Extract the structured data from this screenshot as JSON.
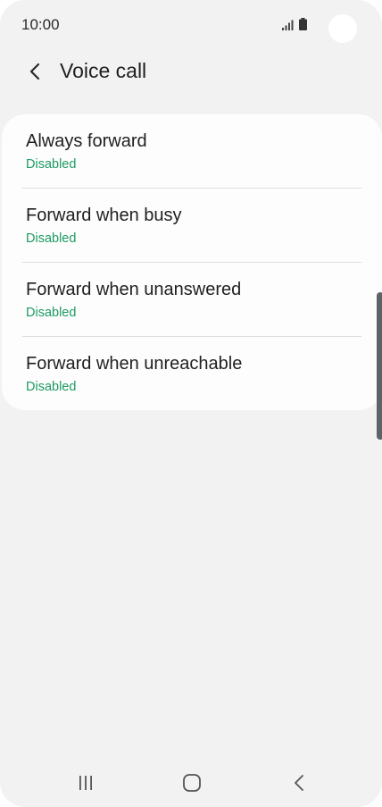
{
  "status_bar": {
    "time": "10:00"
  },
  "header": {
    "title": "Voice call",
    "back_icon": "chevron-left-icon"
  },
  "forward_options": [
    {
      "title": "Always forward",
      "status": "Disabled"
    },
    {
      "title": "Forward when busy",
      "status": "Disabled"
    },
    {
      "title": "Forward when unanswered",
      "status": "Disabled"
    },
    {
      "title": "Forward when unreachable",
      "status": "Disabled"
    }
  ],
  "nav_bar": {
    "recents_icon": "recent-apps-icon",
    "home_icon": "home-icon",
    "back_icon": "back-icon"
  },
  "colors": {
    "background": "#f2f2f2",
    "card": "#fdfdfd",
    "status_text": "#1d9b62",
    "primary_text": "#1f1f1f",
    "scroll_handle": "#5f6368"
  }
}
